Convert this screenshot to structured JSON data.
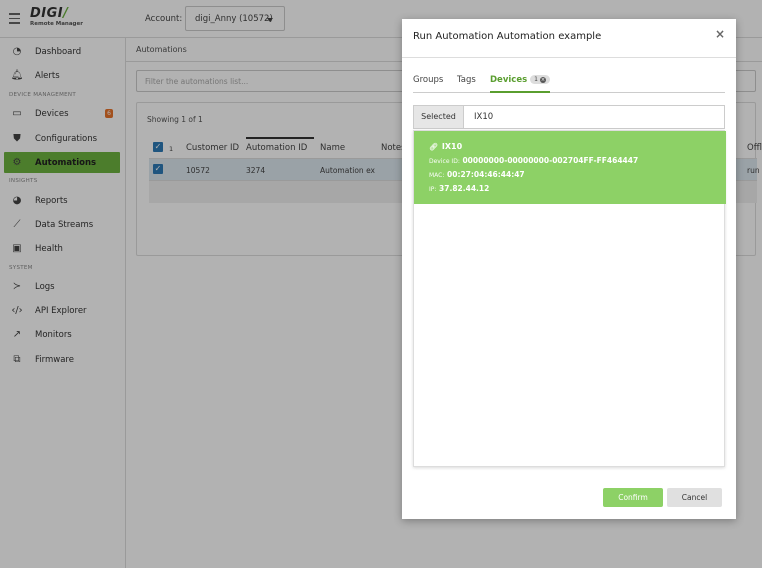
{
  "header": {
    "logo_main": "DIGI",
    "logo_sub": "Remote Manager",
    "account_label": "Account:",
    "account_value": "digi_Anny (10572)"
  },
  "sidebar": {
    "items": [
      {
        "label": "Dashboard",
        "icon": "dashboard-icon"
      },
      {
        "label": "Alerts",
        "icon": "bell-icon"
      },
      {
        "label": "Devices",
        "icon": "devices-icon",
        "badge": "6"
      },
      {
        "label": "Configurations",
        "icon": "shield-icon"
      },
      {
        "label": "Automations",
        "icon": "gears-icon",
        "active": true
      },
      {
        "label": "Reports",
        "icon": "pie-chart-icon"
      },
      {
        "label": "Data Streams",
        "icon": "line-chart-icon"
      },
      {
        "label": "Health",
        "icon": "health-icon"
      },
      {
        "label": "Logs",
        "icon": "terminal-icon"
      },
      {
        "label": "API Explorer",
        "icon": "code-icon"
      },
      {
        "label": "Monitors",
        "icon": "external-link-icon"
      },
      {
        "label": "Firmware",
        "icon": "firmware-icon"
      }
    ],
    "sections": {
      "device_management": "DEVICE MANAGEMENT",
      "insights": "INSIGHTS",
      "system": "SYSTEM"
    }
  },
  "main": {
    "breadcrumb": "Automations",
    "filter_placeholder": "Filter the automations list...",
    "showing": "Showing 1 of 1",
    "table": {
      "headers": [
        "1",
        "Customer ID",
        "Automation ID",
        "Name",
        "Notes",
        "Offl"
      ],
      "row": {
        "customer_id": "10572",
        "automation_id": "3274",
        "name": "Automation ex",
        "notes": "",
        "offl": "run"
      }
    }
  },
  "modal": {
    "title": "Run Automation Automation example",
    "close": "×",
    "tabs": [
      {
        "label": "Groups"
      },
      {
        "label": "Tags"
      },
      {
        "label": "Devices",
        "count": "1",
        "active": true
      }
    ],
    "selected_label": "Selected",
    "search_value": "IX10",
    "device": {
      "name": "IX10",
      "device_id_label": "Device ID:",
      "device_id": "00000000-00000000-002704FF-FF464447",
      "mac_label": "MAC:",
      "mac": "00:27:04:46:44:47",
      "ip_label": "IP:",
      "ip": "37.82.44.12"
    },
    "confirm_label": "Confirm",
    "cancel_label": "Cancel"
  },
  "colors": {
    "accent_green": "#6db33f",
    "card_green": "#8dd166",
    "badge_orange": "#e8732a",
    "checkbox_blue": "#2d7ab7"
  }
}
